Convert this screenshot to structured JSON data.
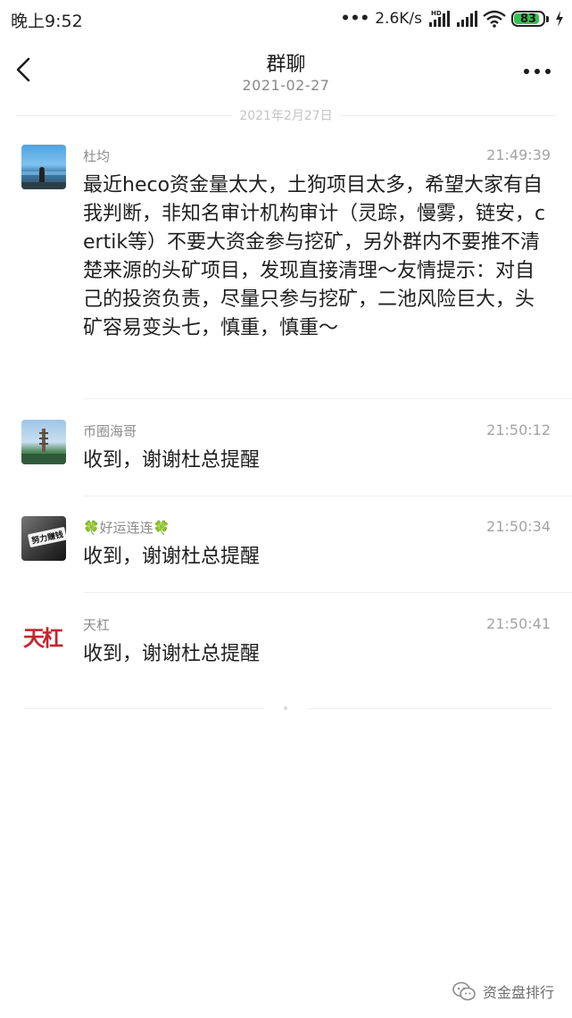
{
  "status_bar": {
    "time": "晚上9:52",
    "dots": "•••",
    "net_speed": "2.6K/s",
    "hd_label": "HD",
    "battery": "83",
    "battery_level": 0.83,
    "icons": [
      "signal-icon",
      "wifi-icon",
      "battery-icon",
      "charging-icon"
    ]
  },
  "header": {
    "title": "群聊",
    "subtitle": "2021-02-27",
    "back_icon": "chevron-left-icon",
    "more_icon": "more-dots-icon"
  },
  "date_divider": "2021年2月27日",
  "messages": [
    {
      "sender": "杜均",
      "time": "21:49:39",
      "text": "最近heco资金量太大，土狗项目太多，希望大家有自我判断，非知名审计机构审计（灵踪，慢雾，链安，certik等）不要大资金参与挖矿，另外群内不要推不清楚来源的头矿项目，发现直接清理～友情提示：对自己的投资负责，尽量只参与挖矿，二池风险巨大，头矿容易变头七，慎重，慎重～"
    },
    {
      "sender": "币圈海哥",
      "time": "21:50:12",
      "text": "收到，谢谢杜总提醒"
    },
    {
      "sender": "🍀好运连连🍀",
      "time": "21:50:34",
      "text": "收到，谢谢杜总提醒",
      "avatar_label": "努力赚钱"
    },
    {
      "sender": "天杠",
      "time": "21:50:41",
      "text": "收到，谢谢杜总提醒",
      "avatar_label": "天杠"
    }
  ],
  "watermark": {
    "text": "资金盘排行",
    "icon": "wechat-icon"
  },
  "colors": {
    "battery_green": "#32c24d",
    "avatar_red": "#c3262f"
  }
}
